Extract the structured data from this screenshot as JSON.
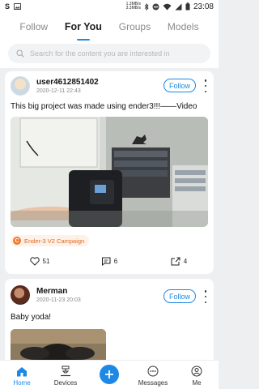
{
  "status": {
    "app_icon": "S",
    "speed_up": "1.3MB/s",
    "speed_down": "3.3MB/s",
    "time": "23:08"
  },
  "tabs": [
    "Follow",
    "For You",
    "Groups",
    "Models"
  ],
  "active_tab": "For You",
  "search": {
    "placeholder": "Search for the content you are interested in"
  },
  "posts": [
    {
      "username": "user4612851402",
      "date": "2020-12-11 22:43",
      "follow_label": "Follow",
      "text": "This big project was made using ender3!!!——Video",
      "campaign": "Ender-3 V2 Campaign",
      "likes": "51",
      "comments": "6",
      "shares": "4"
    },
    {
      "username": "Merman",
      "date": "2020-11-23 20:03",
      "follow_label": "Follow",
      "text": "Baby yoda!"
    }
  ],
  "nav": {
    "home": "Home",
    "devices": "Devices",
    "messages": "Messages",
    "me": "Me"
  },
  "colors": {
    "accent": "#1e88e5",
    "campaign": "#e06a24"
  }
}
